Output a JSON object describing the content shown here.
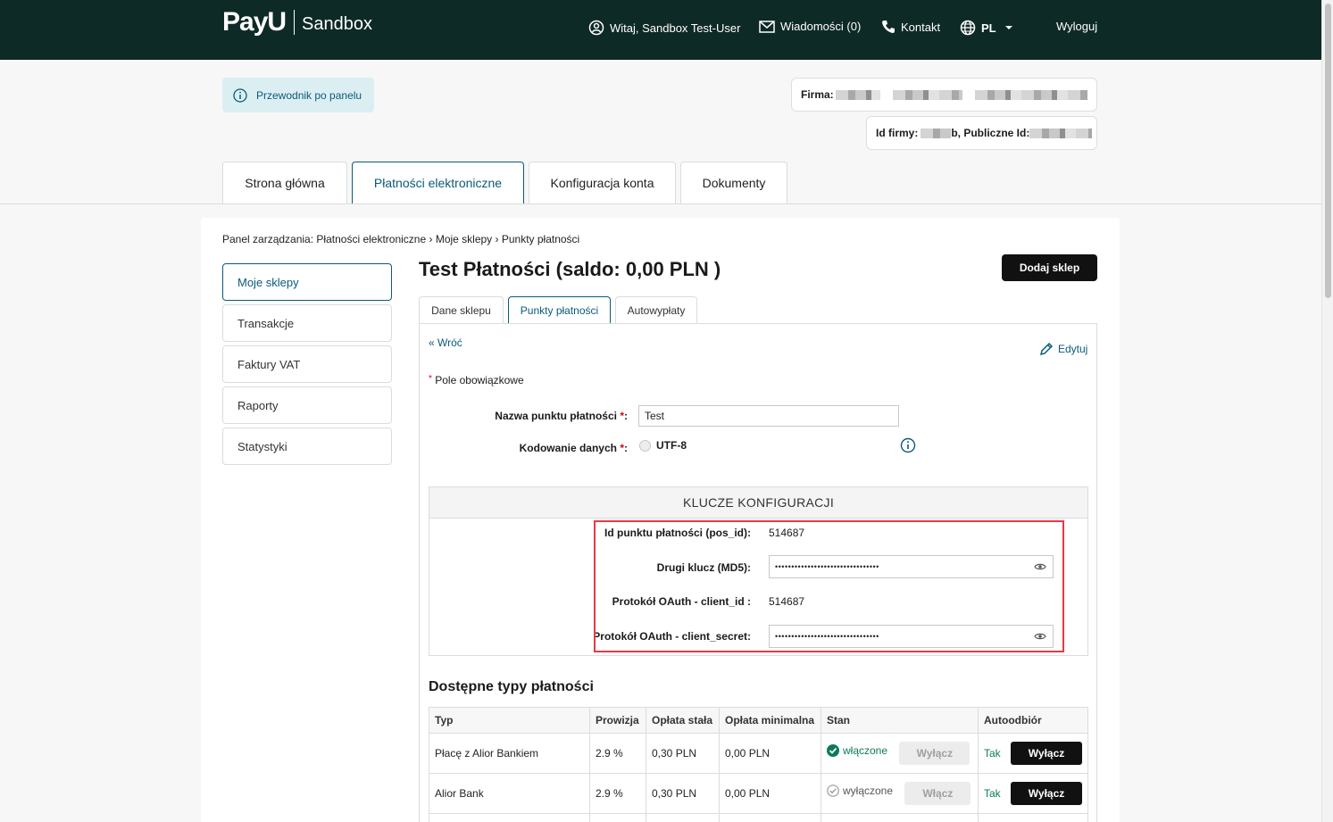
{
  "header": {
    "logo_text": "PayU",
    "env_label": "Sandbox",
    "greeting": "Witaj, Sandbox Test-User",
    "messages": "Wiadomości (0)",
    "contact": "Kontakt",
    "language": "PL",
    "logout": "Wyloguj",
    "icons": [
      "user-circle-icon",
      "envelope-icon",
      "phone-icon",
      "globe-icon",
      "caret-down-icon"
    ]
  },
  "guide": {
    "label": "Przewodnik po panelu",
    "icon": "info-icon"
  },
  "firm": {
    "firma_label": "Firma:",
    "id_label": "Id firmy:",
    "id_suffix": "b, Publiczne Id:"
  },
  "main_tabs": [
    {
      "label": "Strona główna",
      "active": false
    },
    {
      "label": "Płatności elektroniczne",
      "active": true
    },
    {
      "label": "Konfiguracja konta",
      "active": false
    },
    {
      "label": "Dokumenty",
      "active": false
    }
  ],
  "breadcrumb": {
    "prefix": "Panel zarządzania:",
    "path": "Płatności elektroniczne › Moje sklepy › Punkty płatności"
  },
  "sidebar": {
    "items": [
      {
        "label": "Moje sklepy",
        "active": true
      },
      {
        "label": "Transakcje",
        "active": false
      },
      {
        "label": "Faktury VAT",
        "active": false
      },
      {
        "label": "Raporty",
        "active": false
      },
      {
        "label": "Statystyki",
        "active": false
      }
    ]
  },
  "page": {
    "title": "Test Płatności (saldo: 0,00 PLN )",
    "add_shop": "Dodaj sklep"
  },
  "sub_tabs": [
    {
      "label": "Dane sklepu",
      "active": false
    },
    {
      "label": "Punkty płatności",
      "active": true
    },
    {
      "label": "Autowypłaty",
      "active": false
    }
  ],
  "form": {
    "back": "« Wróć",
    "edit": "Edytuj",
    "required_note": "Pole obowiązkowe",
    "pos_name_label": "Nazwa punktu płatności",
    "pos_name_value": "Test",
    "encoding_label": "Kodowanie danych",
    "encoding_value": "UTF-8",
    "required_mark": "*",
    "colon": ":"
  },
  "keys": {
    "title": "KLUCZE KONFIGURACJI",
    "pos_id_label": "Id punktu płatności (pos_id):",
    "pos_id_value": "514687",
    "md5_label": "Drugi klucz (MD5):",
    "md5_value": "••••••••••••••••••••••••••••••••",
    "client_id_label": "Protokół OAuth - client_id :",
    "client_id_value": "514687",
    "client_secret_label": "Protokół OAuth - client_secret:",
    "client_secret_value": "••••••••••••••••••••••••••••••••"
  },
  "payments": {
    "title": "Dostępne typy płatności",
    "columns": [
      "Typ",
      "Prowizja",
      "Opłata stała",
      "Opłata minimalna",
      "Stan",
      "Autoodbiór"
    ],
    "rows": [
      {
        "type": "Płacę z Alior Bankiem",
        "fee": "2.9 %",
        "fixed": "0,30 PLN",
        "minimum": "0,00 PLN",
        "state": "włączone",
        "state_button": "Wyłącz",
        "auto": "Tak",
        "auto_button": "Wyłącz"
      },
      {
        "type": "Alior Bank",
        "fee": "2.9 %",
        "fixed": "0,30 PLN",
        "minimum": "0,00 PLN",
        "state": "wyłączone",
        "state_button": "Włącz",
        "auto": "Tak",
        "auto_button": "Wyłącz"
      }
    ]
  },
  "colors": {
    "topbar": "#0e2a26",
    "accent": "#0b5a7a",
    "highlight": "#e63946",
    "success": "#0b7a5a"
  }
}
